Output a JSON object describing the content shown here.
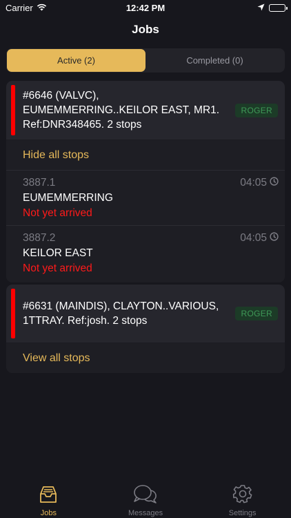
{
  "status_bar": {
    "carrier": "Carrier",
    "time": "12:42 PM"
  },
  "nav": {
    "title": "Jobs"
  },
  "tabs_segment": [
    {
      "label": "Active (2)",
      "active": true
    },
    {
      "label": "Completed (0)",
      "active": false
    }
  ],
  "jobs": [
    {
      "text": "#6646 (VALVC), EUMEMMERRING..KEILOR EAST, MR1. Ref:DNR348465. 2 stops",
      "badge": "ROGER",
      "toggle_label": "Hide all stops",
      "stops": [
        {
          "id": "3887.1",
          "time": "04:05",
          "name": "EUMEMMERRING",
          "status": "Not yet arrived"
        },
        {
          "id": "3887.2",
          "time": "04:05",
          "name": "KEILOR EAST",
          "status": "Not yet arrived"
        }
      ]
    },
    {
      "text": "#6631 (MAINDIS), CLAYTON..VARIOUS, 1TTRAY. Ref:josh. 2 stops",
      "badge": "ROGER",
      "toggle_label": "View all stops"
    }
  ],
  "tab_bar": [
    {
      "label": "Jobs",
      "icon": "inbox-icon",
      "active": true
    },
    {
      "label": "Messages",
      "icon": "chat-bubbles-icon",
      "active": false
    },
    {
      "label": "Settings",
      "icon": "gear-icon",
      "active": false
    }
  ],
  "colors": {
    "accent": "#e6b95a",
    "background": "#17171d",
    "card": "#26262d",
    "alert": "#ff1a1a",
    "badge_text": "#3f9a58"
  }
}
